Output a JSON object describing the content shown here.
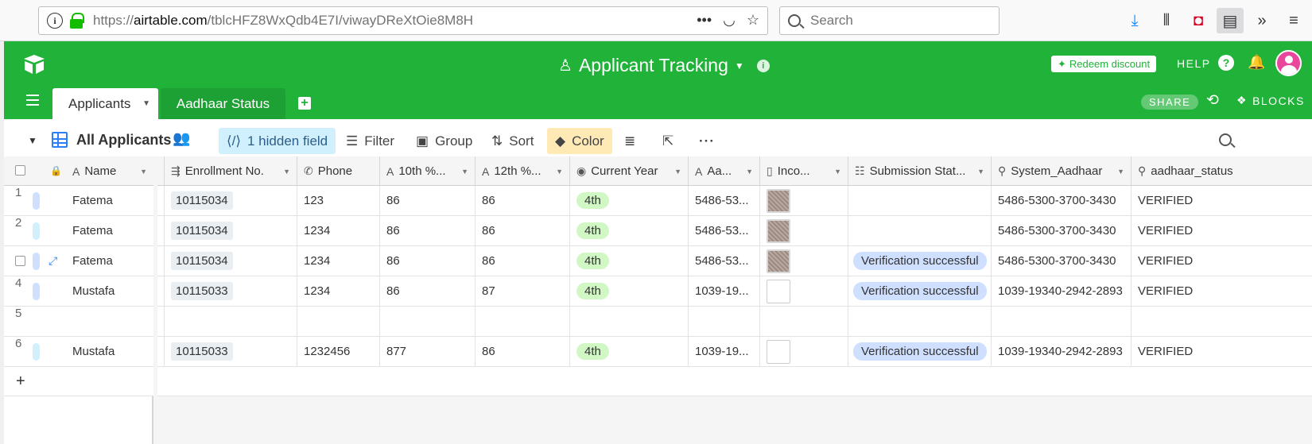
{
  "browser": {
    "url_prefix": "https://",
    "url_host": "airtable.com",
    "url_path": "/tblcHFZ8WxQdb4E7I/viwayDReXtOie8M8H",
    "search_placeholder": "Search"
  },
  "header": {
    "base_title": "Applicant Tracking",
    "redeem_label": "Redeem discount",
    "help_label": "HELP",
    "share_label": "SHARE",
    "blocks_label": "BLOCKS"
  },
  "tabs": [
    {
      "label": "Applicants",
      "active": true
    },
    {
      "label": "Aadhaar Status",
      "active": false
    }
  ],
  "viewbar": {
    "view_name": "All Applicants",
    "hidden_label": "1 hidden field",
    "filter_label": "Filter",
    "group_label": "Group",
    "sort_label": "Sort",
    "color_label": "Color"
  },
  "columns": {
    "name": "Name",
    "enrollment": "Enrollment No.",
    "phone": "Phone",
    "tenth": "10th %...",
    "twelfth": "12th %...",
    "current_year": "Current Year",
    "aadhaar": "Aa...",
    "income": "Inco...",
    "submission": "Submission Stat...",
    "system_aadhaar": "System_Aadhaar",
    "aadhaar_status": "aadhaar_status"
  },
  "rows": [
    {
      "num": "1",
      "name": "Fatema",
      "enrollment": "10115034",
      "phone": "123",
      "tenth": "86",
      "twelfth": "86",
      "year": "4th",
      "aadhaar": "5486-53...",
      "submission": "",
      "system_aadhaar": "5486-5300-3700-3430",
      "status": "VERIFIED"
    },
    {
      "num": "2",
      "name": "Fatema",
      "enrollment": "10115034",
      "phone": "1234",
      "tenth": "86",
      "twelfth": "86",
      "year": "4th",
      "aadhaar": "5486-53...",
      "submission": "",
      "system_aadhaar": "5486-5300-3700-3430",
      "status": "VERIFIED"
    },
    {
      "num": "",
      "name": "Fatema",
      "enrollment": "10115034",
      "phone": "1234",
      "tenth": "86",
      "twelfth": "86",
      "year": "4th",
      "aadhaar": "5486-53...",
      "submission": "Verification successful",
      "system_aadhaar": "5486-5300-3700-3430",
      "status": "VERIFIED"
    },
    {
      "num": "4",
      "name": "Mustafa",
      "enrollment": "10115033",
      "phone": "1234",
      "tenth": "86",
      "twelfth": "87",
      "year": "4th",
      "aadhaar": "1039-19...",
      "submission": "Verification successful",
      "system_aadhaar": "1039-19340-2942-2893",
      "status": "VERIFIED"
    },
    {
      "num": "5",
      "name": "",
      "enrollment": "",
      "phone": "",
      "tenth": "",
      "twelfth": "",
      "year": "",
      "aadhaar": "",
      "submission": "",
      "system_aadhaar": "",
      "status": ""
    },
    {
      "num": "6",
      "name": "Mustafa",
      "enrollment": "10115033",
      "phone": "1232456",
      "tenth": "877",
      "twelfth": "86",
      "year": "4th",
      "aadhaar": "1039-19...",
      "submission": "Verification successful",
      "system_aadhaar": "1039-19340-2942-2893",
      "status": "VERIFIED"
    }
  ],
  "add_row_label": "+",
  "colors": {
    "brand": "#20b239",
    "accent": "#2d7ff9"
  }
}
